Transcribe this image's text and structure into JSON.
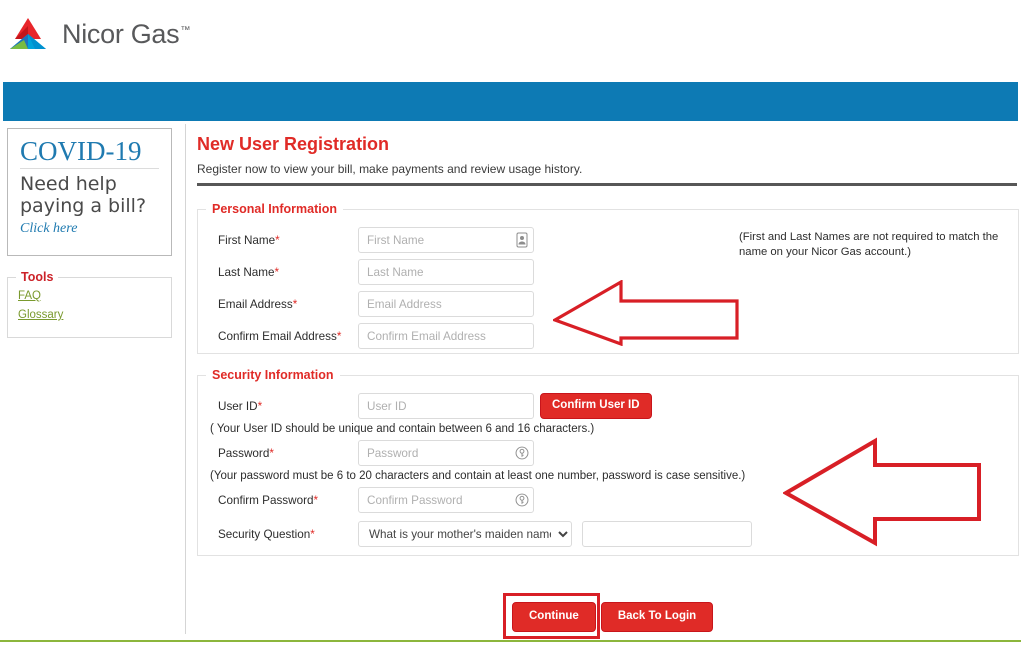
{
  "brand": {
    "name": "Nicor Gas",
    "trademark": "™",
    "logo_icon": "nicor-gas-triangle-logo"
  },
  "nav": {
    "color": "#0d7ab4"
  },
  "sidebar": {
    "covid": {
      "title": "COVID-19",
      "subtitle": "Need help paying a bill?",
      "link": "Click here"
    },
    "tools": {
      "legend": "Tools",
      "links": [
        "FAQ",
        "Glossary"
      ]
    }
  },
  "main": {
    "title": "New User Registration",
    "subtitle": "Register now to view your bill, make payments and review usage history.",
    "personal": {
      "legend": "Personal Information",
      "note": "(First and Last Names are not required to match the name on your Nicor Gas account.)",
      "fields": [
        {
          "label": "First Name",
          "required": "*",
          "placeholder": "First Name",
          "value": "",
          "icon": "contact-card-icon"
        },
        {
          "label": "Last Name",
          "required": "*",
          "placeholder": "Last Name",
          "value": "",
          "icon": ""
        },
        {
          "label": "Email Address",
          "required": "*",
          "placeholder": "Email Address",
          "value": "",
          "icon": ""
        },
        {
          "label": "Confirm Email Address",
          "required": "*",
          "placeholder": "Confirm Email Address",
          "value": "",
          "icon": ""
        }
      ]
    },
    "security": {
      "legend": "Security Information",
      "userid": {
        "label": "User ID",
        "required": "*",
        "placeholder": "User ID",
        "value": "",
        "confirm_button": "Confirm User ID",
        "hint": "( Your User ID should be unique and contain between 6 and 16 characters.)"
      },
      "password": {
        "label": "Password",
        "required": "*",
        "placeholder": "Password",
        "value": "",
        "icon": "key-circle-icon",
        "hint": "(Your password must be 6 to 20 characters and contain at least one number, password is case sensitive.)"
      },
      "confirm_password": {
        "label": "Confirm Password",
        "required": "*",
        "placeholder": "Confirm Password",
        "value": "",
        "icon": "key-circle-icon"
      },
      "security_question": {
        "label": "Security Question",
        "required": "*",
        "selected": "What is your mother's maiden name?",
        "options": [
          "What is your mother's maiden name?"
        ],
        "answer_value": "",
        "answer_placeholder": ""
      }
    },
    "actions": {
      "continue": "Continue",
      "back_to_login": "Back To Login"
    }
  },
  "annotations": {
    "color": "#d81f26",
    "arrow_1": "left-arrow-pointing-to-personal-information",
    "arrow_2": "left-arrow-pointing-to-security-information",
    "highlight_rect": "continue-button-highlight"
  },
  "footer": {
    "accent_color": "#8cb63c"
  }
}
